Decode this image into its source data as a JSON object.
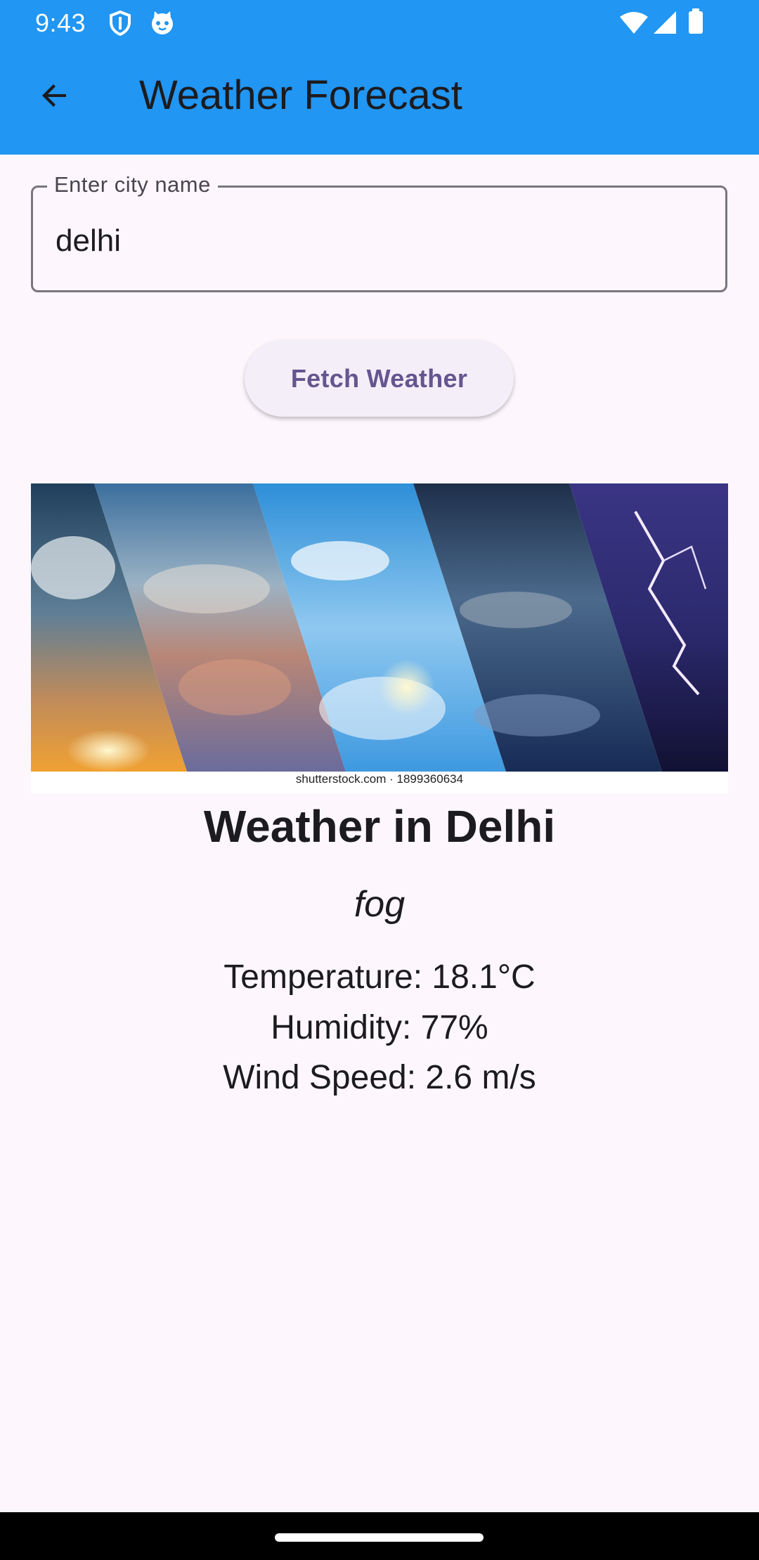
{
  "status_bar": {
    "time": "9:43",
    "left_icons": [
      "shield-icon",
      "cat-face-icon"
    ],
    "right_icons": [
      "wifi-icon",
      "cell-signal-icon",
      "battery-icon"
    ]
  },
  "app_bar": {
    "title": "Weather Forecast",
    "back_icon": "arrow-back-icon",
    "color": "#2196f3"
  },
  "search": {
    "label": "Enter city name",
    "value": "delhi"
  },
  "fetch_button": {
    "label": "Fetch Weather",
    "color": "#65558f"
  },
  "weather_image": {
    "credit": "shutterstock.com · 1899360634"
  },
  "result": {
    "title": "Weather in Delhi",
    "description": "fog",
    "temperature": "Temperature: 18.1°C",
    "humidity": "Humidity: 77%",
    "wind_speed": "Wind Speed: 2.6 m/s"
  }
}
